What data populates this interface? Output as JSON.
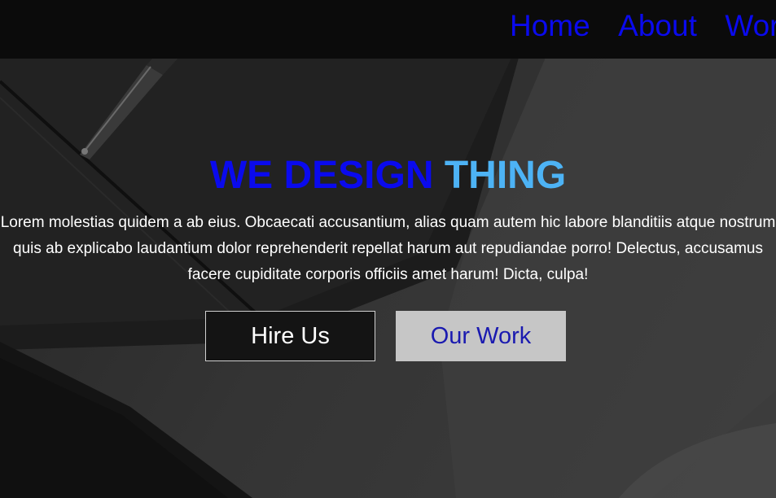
{
  "nav": {
    "items": [
      {
        "label": "Home"
      },
      {
        "label": "About"
      },
      {
        "label": "Work"
      }
    ]
  },
  "hero": {
    "title_part1": "WE DESIGN",
    "title_part2": "THING",
    "description": "Lorem molestias quidem a ab eius. Obcaecati accusantium, alias quam autem hic labore blanditiis atque nostrum quis ab explicabo laudantium dolor reprehenderit repellat harum aut repudiandae porro! Delectus, accusamus facere cupiditate corporis officiis amet harum! Dicta, culpa!",
    "buttons": {
      "hire_label": "Hire Us",
      "work_label": "Our Work"
    }
  },
  "colors": {
    "nav_link": "#0a0aee",
    "title_primary": "#0a0aee",
    "title_accent": "#4db3f5",
    "navbar_bg": "#0b0b0b",
    "work_button_bg": "#c6c6c6"
  }
}
